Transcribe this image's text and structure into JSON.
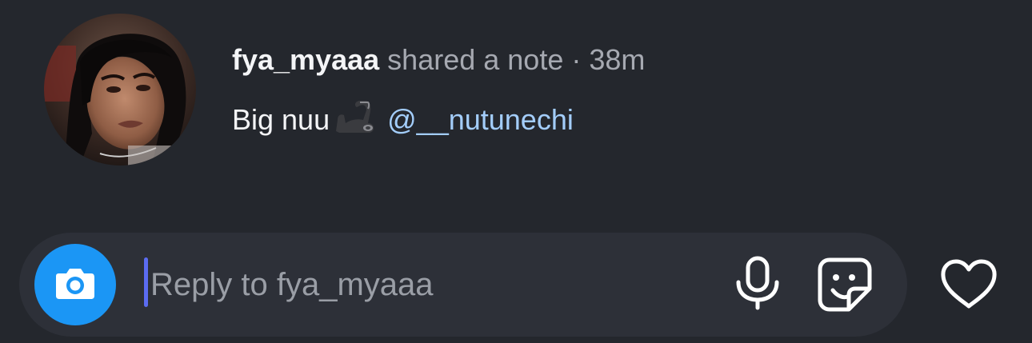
{
  "note": {
    "avatar_icon": "profile-photo",
    "username": "fya_myaaa",
    "action": "shared a note",
    "separator": "·",
    "time": "38m",
    "text": "Big nuu",
    "emoji": "flexed-biceps-emoji",
    "mention": "@__nutunechi"
  },
  "reply_bar": {
    "camera_icon": "camera-icon",
    "placeholder": "Reply to fya_myaaa",
    "value": "",
    "mic_icon": "microphone-icon",
    "sticker_icon": "sticker-icon",
    "like_icon": "heart-icon"
  },
  "colors": {
    "background": "#24272d",
    "pill": "#2d3038",
    "camera_accent": "#1b96f5",
    "mention": "#a3cdfa",
    "caret": "#5b6cf2"
  }
}
